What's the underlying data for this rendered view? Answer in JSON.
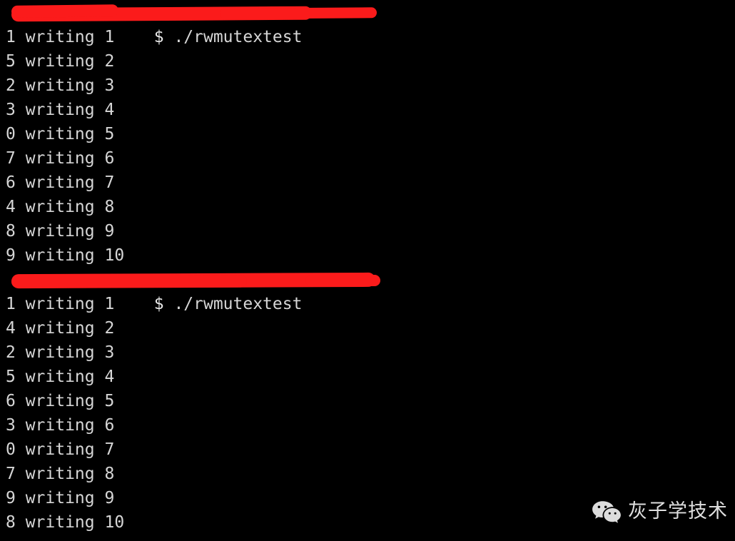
{
  "terminal": {
    "background_color": "#000000",
    "text_color": "#d6d6d6",
    "redaction_color": "#fb1b1b",
    "prompt_sigil": "$",
    "command": "./rwmutextest",
    "redacted_host_text": "         ",
    "sessions": [
      {
        "prompt": {
          "host_masked": "         ",
          "sigil": "$",
          "command": "./rwmutextest"
        },
        "output": [
          "1 writing 1",
          "5 writing 2",
          "2 writing 3",
          "3 writing 4",
          "0 writing 5",
          "7 writing 6",
          "6 writing 7",
          "4 writing 8",
          "8 writing 9",
          "9 writing 10"
        ]
      },
      {
        "prompt": {
          "host_masked": "         ",
          "sigil": "$",
          "command": "./rwmutextest"
        },
        "output": [
          "1 writing 1",
          "4 writing 2",
          "2 writing 3",
          "5 writing 4",
          "6 writing 5",
          "3 writing 6",
          "0 writing 7",
          "7 writing 8",
          "9 writing 9",
          "8 writing 10"
        ]
      }
    ],
    "partial_bottom_line": "                                        "
  },
  "watermark": {
    "icon": "wechat-icon",
    "label": "灰子学技术"
  }
}
